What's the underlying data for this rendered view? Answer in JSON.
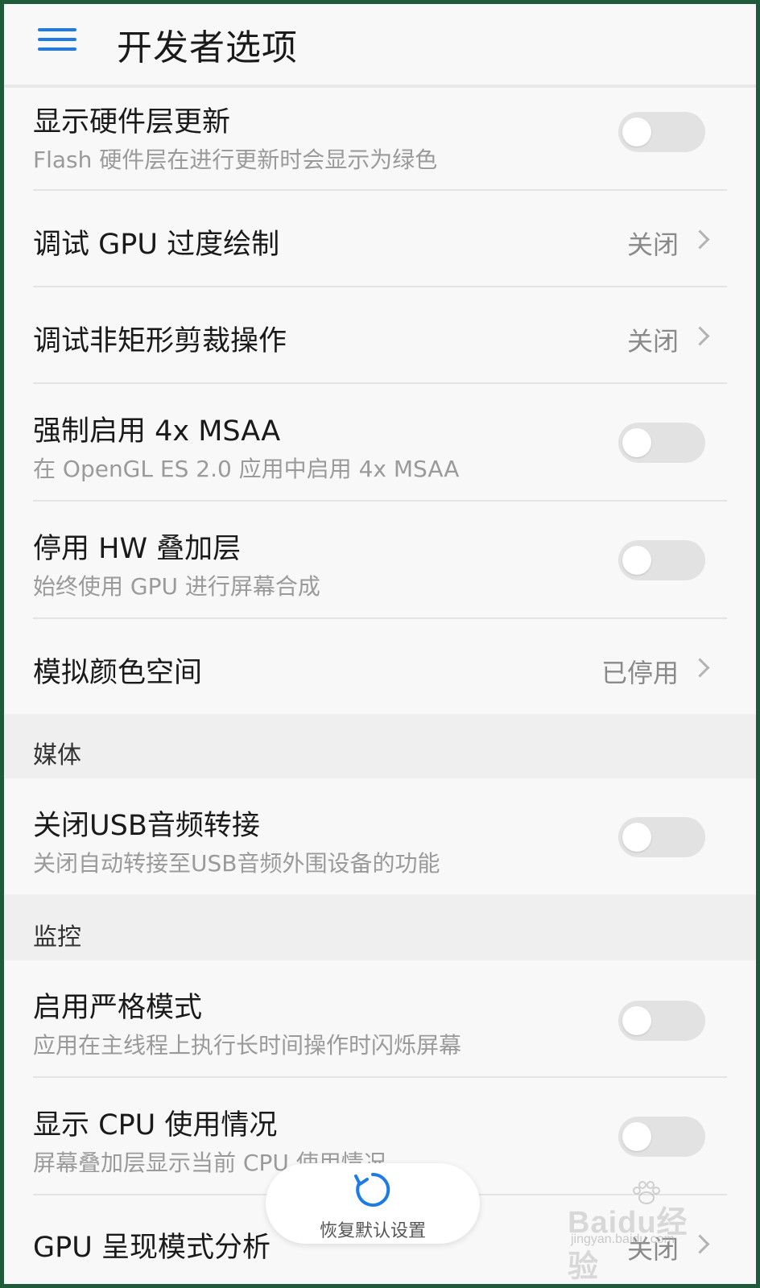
{
  "header": {
    "title": "开发者选项",
    "menu_icon": "hamburger-menu-icon",
    "accent_color": "#1e7be6"
  },
  "rows": {
    "hw_layers": {
      "title": "显示硬件层更新",
      "subtitle": "Flash 硬件层在进行更新时会显示为绿色",
      "toggle_on": false
    },
    "gpu_overdraw": {
      "title": "调试 GPU 过度绘制",
      "value": "关闭"
    },
    "non_rect_clip": {
      "title": "调试非矩形剪裁操作",
      "value": "关闭"
    },
    "msaa": {
      "title": "强制启用 4x MSAA",
      "subtitle": "在 OpenGL ES 2.0 应用中启用 4x MSAA",
      "toggle_on": false
    },
    "hw_overlay": {
      "title": "停用 HW 叠加层",
      "subtitle": "始终使用 GPU 进行屏幕合成",
      "toggle_on": false
    },
    "color_space": {
      "title": "模拟颜色空间",
      "value": "已停用"
    },
    "usb_audio": {
      "title": "关闭USB音频转接",
      "subtitle": "关闭自动转接至USB音频外围设备的功能",
      "toggle_on": false
    },
    "strict_mode": {
      "title": "启用严格模式",
      "subtitle": "应用在主线程上执行长时间操作时闪烁屏幕",
      "toggle_on": false
    },
    "cpu_usage": {
      "title": "显示 CPU 使用情况",
      "subtitle": "屏幕叠加层显示当前 CPU 使用情况",
      "toggle_on": false
    },
    "gpu_profile": {
      "title": "GPU 呈现模式分析",
      "value": "关闭"
    }
  },
  "sections": {
    "media": "媒体",
    "monitoring": "监控"
  },
  "restore_button": {
    "label": "恢复默认设置",
    "icon": "refresh-icon"
  },
  "watermark": {
    "main": "Baidu经验",
    "sub": "jingyan.baidu.com"
  }
}
